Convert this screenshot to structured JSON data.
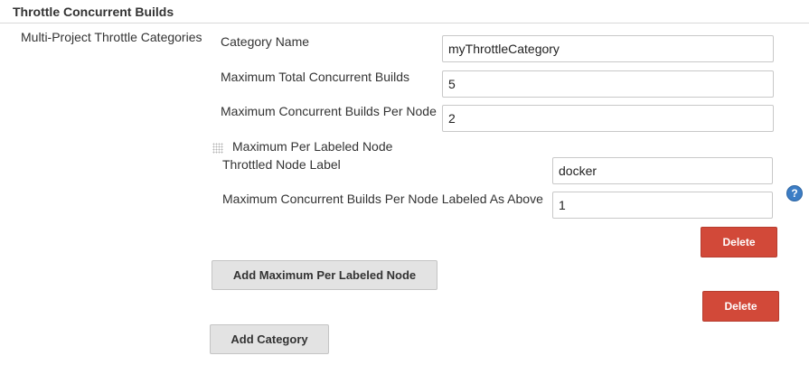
{
  "section": {
    "title": "Throttle Concurrent Builds"
  },
  "sidebar_label": "Multi-Project Throttle Categories",
  "category": {
    "name_label": "Category Name",
    "name_value": "myThrottleCategory",
    "max_total_label": "Maximum Total Concurrent Builds",
    "max_total_value": "5",
    "max_per_node_label": "Maximum Concurrent Builds Per Node",
    "max_per_node_value": "2",
    "labeled_node": {
      "heading": "Maximum Per Labeled Node",
      "label_label": "Throttled Node Label",
      "label_value": "docker",
      "max_label": "Maximum Concurrent Builds Per Node Labeled As Above",
      "max_value": "1",
      "delete_label": "Delete"
    },
    "add_labeled_node_label": "Add Maximum Per Labeled Node",
    "delete_label": "Delete"
  },
  "add_category_label": "Add Category",
  "help_icon": "?",
  "icons": {
    "drag_handle": "drag-handle-icon",
    "help": "help-icon"
  },
  "colors": {
    "delete_button": "#d24939",
    "grey_button": "#e3e3e3",
    "help_icon": "#3c7dc5"
  }
}
